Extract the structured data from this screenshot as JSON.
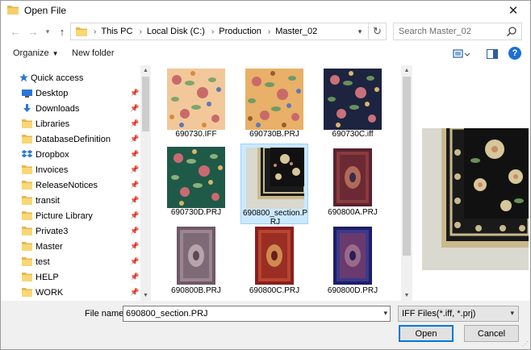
{
  "window": {
    "title": "Open File",
    "close_label": "✕"
  },
  "address": {
    "crumbs": [
      "This PC",
      "Local Disk (C:)",
      "Production",
      "Master_02"
    ],
    "search_placeholder": "Search Master_02"
  },
  "toolbar": {
    "organize_label": "Organize",
    "new_folder_label": "New folder",
    "help_label": "?"
  },
  "nav": {
    "quick_access_label": "Quick access",
    "items": [
      {
        "label": "Desktop",
        "icon": "desktop-icon",
        "pinned": true
      },
      {
        "label": "Downloads",
        "icon": "download-icon",
        "pinned": true
      },
      {
        "label": "Libraries",
        "icon": "folder-icon",
        "pinned": true
      },
      {
        "label": "DatabaseDefinition",
        "icon": "folder-icon",
        "pinned": true
      },
      {
        "label": "Dropbox",
        "icon": "dropbox-icon",
        "pinned": true
      },
      {
        "label": "Invoices",
        "icon": "folder-icon",
        "pinned": true
      },
      {
        "label": "ReleaseNotices",
        "icon": "folder-icon",
        "pinned": true
      },
      {
        "label": "transit",
        "icon": "folder-icon",
        "pinned": true
      },
      {
        "label": "Picture Library",
        "icon": "folder-icon",
        "pinned": true
      },
      {
        "label": "Private3",
        "icon": "folder-icon",
        "pinned": true
      },
      {
        "label": "Master",
        "icon": "folder-icon",
        "pinned": true
      },
      {
        "label": "test",
        "icon": "folder-icon",
        "pinned": true
      },
      {
        "label": "HELP",
        "icon": "folder-icon",
        "pinned": true
      },
      {
        "label": "WORK",
        "icon": "folder-icon",
        "pinned": true
      }
    ]
  },
  "files": [
    {
      "name": "690730.IFF",
      "pattern": "floral-peach",
      "selected": false
    },
    {
      "name": "690730B.PRJ",
      "pattern": "floral-gold",
      "selected": false
    },
    {
      "name": "690730C.iff",
      "pattern": "floral-navy",
      "selected": false
    },
    {
      "name": "690730D.PRJ",
      "pattern": "floral-green",
      "selected": false
    },
    {
      "name": "690800_section.PRJ",
      "pattern": "rug-section",
      "selected": true
    },
    {
      "name": "690800A.PRJ",
      "pattern": "rug-red-dark",
      "selected": false
    },
    {
      "name": "690800B.PRJ",
      "pattern": "rug-mauve",
      "selected": false
    },
    {
      "name": "690800C.PRJ",
      "pattern": "rug-red",
      "selected": false
    },
    {
      "name": "690800D.PRJ",
      "pattern": "rug-blue",
      "selected": false
    }
  ],
  "footer": {
    "file_name_label": "File name:",
    "file_name_value": "690800_section.PRJ",
    "filter_value": "IFF Files(*.iff, *.prj)",
    "open_label": "Open",
    "cancel_label": "Cancel"
  },
  "colors": {
    "accent": "#0078d7",
    "selection_bg": "#cce8ff",
    "selection_border": "#99d1ff",
    "folder": "#e8b64a"
  }
}
